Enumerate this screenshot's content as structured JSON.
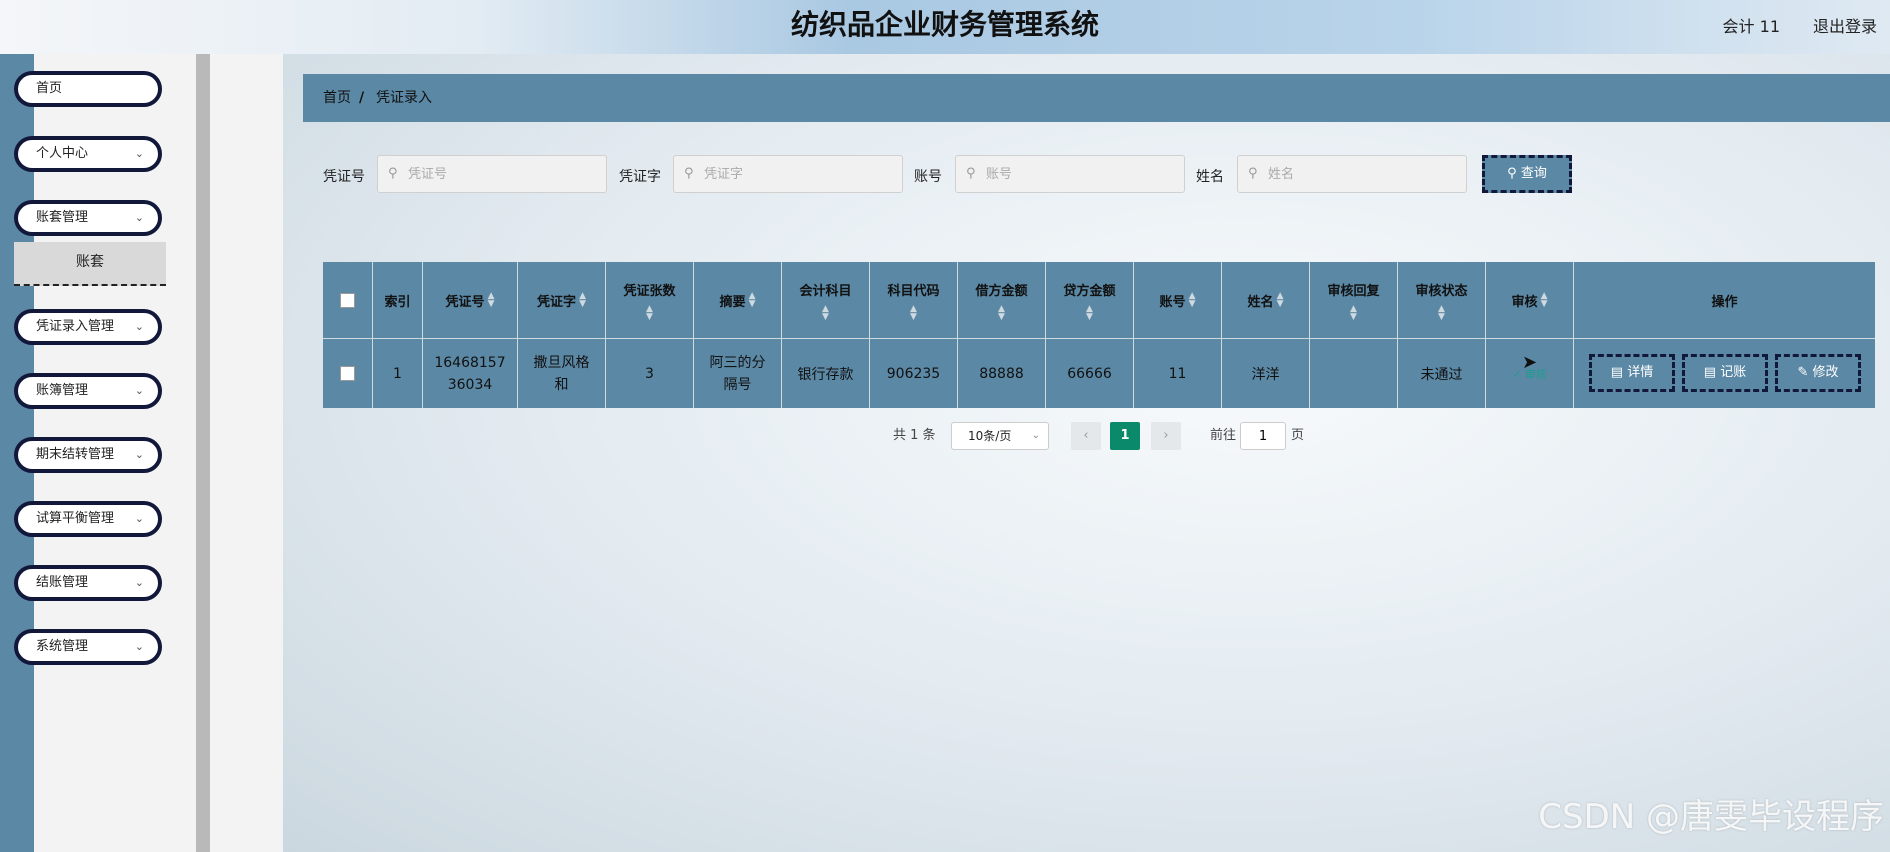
{
  "header": {
    "title": "纺织品企业财务管理系统",
    "user": "会计 11",
    "logout": "退出登录"
  },
  "sidebar": {
    "items": [
      {
        "label": "首页",
        "expandable": false
      },
      {
        "label": "个人中心",
        "expandable": true
      },
      {
        "label": "账套管理",
        "expandable": true
      },
      {
        "label": "凭证录入管理",
        "expandable": true
      },
      {
        "label": "账簿管理",
        "expandable": true
      },
      {
        "label": "期末结转管理",
        "expandable": true
      },
      {
        "label": "试算平衡管理",
        "expandable": true
      },
      {
        "label": "结账管理",
        "expandable": true
      },
      {
        "label": "系统管理",
        "expandable": true
      }
    ],
    "submenu": {
      "label": "账套"
    }
  },
  "breadcrumb": {
    "home": "首页",
    "separator": "/",
    "current": "凭证录入"
  },
  "search": {
    "fields": [
      {
        "label": "凭证号",
        "placeholder": "凭证号"
      },
      {
        "label": "凭证字",
        "placeholder": "凭证字"
      },
      {
        "label": "账号",
        "placeholder": "账号"
      },
      {
        "label": "姓名",
        "placeholder": "姓名"
      }
    ],
    "query_button": "查询"
  },
  "table": {
    "headers": [
      "索引",
      "凭证号",
      "凭证字",
      "凭证张数",
      "摘要",
      "会计科目",
      "科目代码",
      "借方金额",
      "贷方金额",
      "账号",
      "姓名",
      "审核回复",
      "审核状态",
      "审核",
      "操作"
    ],
    "rows": [
      {
        "index": "1",
        "voucher_no": "1646815736034",
        "voucher_word": "撒旦风格和",
        "voucher_count": "3",
        "summary": "阿三的分隔号",
        "subject": "银行存款",
        "subject_code": "906235",
        "debit": "88888",
        "credit": "66666",
        "account": "11",
        "name": "洋洋",
        "audit_reply": "",
        "audit_status": "未通过",
        "audit_link": "审核",
        "actions": [
          "详情",
          "记账",
          "修改"
        ]
      }
    ]
  },
  "pagination": {
    "total": "共 1 条",
    "page_size": "10条/页",
    "current_page": "1",
    "goto_label": "前往",
    "goto_value": "1",
    "page_unit": "页"
  },
  "watermark": "CSDN @唐雯毕设程序",
  "colors": {
    "primary": "#5b88a5",
    "border_dark": "#12183a",
    "pager_active": "#0b8a6b"
  }
}
